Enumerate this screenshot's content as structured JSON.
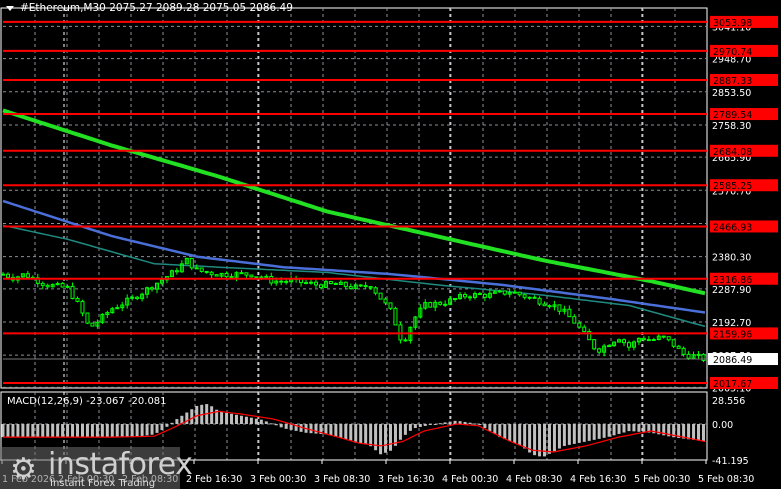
{
  "header": {
    "symbol": "#Ethereum,M30",
    "open": "2075.27",
    "high": "2089.28",
    "low": "2075.05",
    "close": "2086.49"
  },
  "macd_label": {
    "name": "MACD(12,26,9)",
    "main": "-23.067",
    "signal": "-20.081"
  },
  "watermark": {
    "brand": "instaforex",
    "tagline": "Instant Forex Trading"
  },
  "colors": {
    "bg": "#000000",
    "candle": "#00ff00",
    "level": "#ff0000",
    "ma_slow": "#22e022",
    "ma_mid": "#4a6fd8",
    "ma_fast": "#1f8a80",
    "hist": "#c0c0c0",
    "signal": "#ff0000"
  },
  "chart_data": [
    {
      "type": "candlestick",
      "title": "#Ethereum,M30",
      "ylim": [
        2005.1,
        3053.98
      ],
      "y_ticks": [
        "3041.10",
        "2948.70",
        "2853.50",
        "2758.30",
        "2665.90",
        "2570.70",
        "2475.50",
        "2380.30",
        "2287.90",
        "2192.70",
        "2097.50",
        "2005.10"
      ],
      "levels": [
        "3053.98",
        "2970.74",
        "2887.33",
        "2789.54",
        "2684.08",
        "2585.25",
        "2466.93",
        "2316.86",
        "2159.96",
        "2017.67"
      ],
      "current_price": "2086.49",
      "x_ticks": [
        "1 Feb 2026",
        "2 Feb 00:30",
        "2 Feb 08:30",
        "2 Feb 16:30",
        "3 Feb 00:30",
        "3 Feb 08:30",
        "3 Feb 16:30",
        "4 Feb 00:30",
        "4 Feb 08:30",
        "4 Feb 16:30",
        "5 Feb 00:30",
        "5 Feb 08:30"
      ],
      "close_path": [
        [
          0,
          2330
        ],
        [
          10,
          2320
        ],
        [
          20,
          2330
        ],
        [
          40,
          2300
        ],
        [
          60,
          2290
        ],
        [
          70,
          2240
        ],
        [
          80,
          2175
        ],
        [
          90,
          2200
        ],
        [
          100,
          2230
        ],
        [
          120,
          2260
        ],
        [
          140,
          2300
        ],
        [
          160,
          2340
        ],
        [
          170,
          2370
        ],
        [
          180,
          2340
        ],
        [
          200,
          2330
        ],
        [
          230,
          2330
        ],
        [
          250,
          2310
        ],
        [
          270,
          2310
        ],
        [
          290,
          2300
        ],
        [
          310,
          2300
        ],
        [
          330,
          2290
        ],
        [
          340,
          2300
        ],
        [
          350,
          2260
        ],
        [
          360,
          2220
        ],
        [
          370,
          2130
        ],
        [
          380,
          2200
        ],
        [
          390,
          2240
        ],
        [
          410,
          2250
        ],
        [
          430,
          2270
        ],
        [
          450,
          2270
        ],
        [
          470,
          2280
        ],
        [
          490,
          2260
        ],
        [
          510,
          2240
        ],
        [
          520,
          2220
        ],
        [
          530,
          2190
        ],
        [
          540,
          2150
        ],
        [
          550,
          2110
        ],
        [
          560,
          2130
        ],
        [
          570,
          2150
        ],
        [
          580,
          2120
        ],
        [
          590,
          2150
        ],
        [
          600,
          2140
        ],
        [
          610,
          2150
        ],
        [
          620,
          2130
        ],
        [
          630,
          2100
        ],
        [
          640,
          2095
        ],
        [
          650,
          2086
        ]
      ],
      "ma_slow": [
        [
          0,
          2800
        ],
        [
          100,
          2700
        ],
        [
          200,
          2610
        ],
        [
          300,
          2510
        ],
        [
          400,
          2440
        ],
        [
          500,
          2370
        ],
        [
          600,
          2310
        ],
        [
          650,
          2275
        ]
      ],
      "ma_mid": [
        [
          0,
          2540
        ],
        [
          100,
          2440
        ],
        [
          180,
          2380
        ],
        [
          260,
          2350
        ],
        [
          360,
          2330
        ],
        [
          460,
          2300
        ],
        [
          560,
          2260
        ],
        [
          650,
          2220
        ]
      ],
      "ma_fast": [
        [
          0,
          2470
        ],
        [
          60,
          2430
        ],
        [
          140,
          2360
        ],
        [
          200,
          2350
        ],
        [
          300,
          2335
        ],
        [
          400,
          2300
        ],
        [
          500,
          2270
        ],
        [
          580,
          2240
        ],
        [
          650,
          2180
        ]
      ],
      "macd_ylim": [
        -41.195,
        28.556
      ],
      "macd_ticks": [
        "28.556",
        "0.00",
        "-41.195"
      ],
      "macd_hist": [
        [
          0,
          -15
        ],
        [
          60,
          -15
        ],
        [
          120,
          -15
        ],
        [
          140,
          -12
        ],
        [
          150,
          -5
        ],
        [
          160,
          5
        ],
        [
          180,
          22
        ],
        [
          190,
          24
        ],
        [
          200,
          15
        ],
        [
          220,
          10
        ],
        [
          240,
          5
        ],
        [
          260,
          -5
        ],
        [
          280,
          -10
        ],
        [
          300,
          -12
        ],
        [
          320,
          -18
        ],
        [
          340,
          -25
        ],
        [
          350,
          -35
        ],
        [
          360,
          -30
        ],
        [
          370,
          -15
        ],
        [
          380,
          -5
        ],
        [
          400,
          0
        ],
        [
          420,
          4
        ],
        [
          440,
          0
        ],
        [
          460,
          -15
        ],
        [
          480,
          -25
        ],
        [
          490,
          -35
        ],
        [
          500,
          -38
        ],
        [
          520,
          -25
        ],
        [
          540,
          -20
        ],
        [
          560,
          -15
        ],
        [
          580,
          -8
        ],
        [
          600,
          -10
        ],
        [
          620,
          -15
        ],
        [
          650,
          -20
        ]
      ],
      "macd_signal": [
        [
          0,
          -15
        ],
        [
          100,
          -15
        ],
        [
          140,
          -14
        ],
        [
          160,
          -3
        ],
        [
          180,
          10
        ],
        [
          200,
          15
        ],
        [
          220,
          12
        ],
        [
          250,
          6
        ],
        [
          280,
          -5
        ],
        [
          310,
          -15
        ],
        [
          330,
          -22
        ],
        [
          350,
          -25
        ],
        [
          370,
          -20
        ],
        [
          390,
          -8
        ],
        [
          420,
          0
        ],
        [
          440,
          -2
        ],
        [
          470,
          -20
        ],
        [
          490,
          -30
        ],
        [
          510,
          -32
        ],
        [
          540,
          -25
        ],
        [
          570,
          -15
        ],
        [
          600,
          -8
        ],
        [
          630,
          -15
        ],
        [
          650,
          -20
        ]
      ]
    }
  ]
}
